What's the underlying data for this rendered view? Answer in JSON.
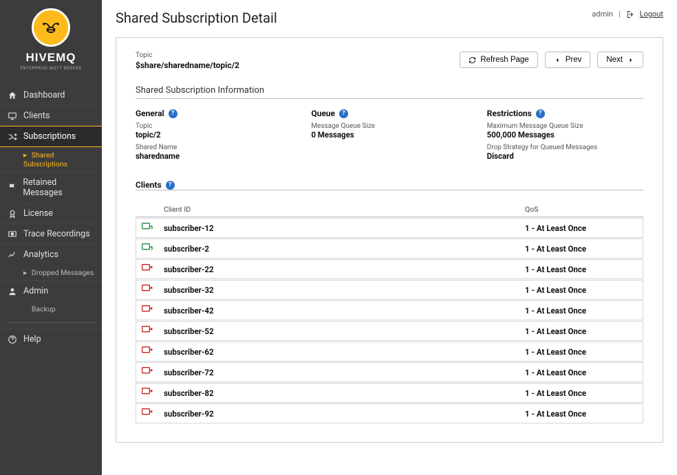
{
  "brand": {
    "name": "HIVEMQ",
    "tagline": "ENTERPRISE MQTT BROKER"
  },
  "nav": {
    "dashboard": "Dashboard",
    "clients": "Clients",
    "subscriptions": "Subscriptions",
    "shared_subscriptions": "Shared Subscriptions",
    "retained": "Retained Messages",
    "license": "License",
    "trace": "Trace Recordings",
    "analytics": "Analytics",
    "dropped": "Dropped Messages",
    "admin": "Admin",
    "backup": "Backup",
    "help": "Help"
  },
  "user": {
    "name": "admin",
    "logout": "Logout"
  },
  "page": {
    "title": "Shared Subscription Detail",
    "topic_label": "Topic",
    "topic_value": "$share/sharedname/topic/2",
    "refresh": "Refresh Page",
    "prev": "Prev",
    "next": "Next",
    "section_info": "Shared Subscription Information",
    "general": {
      "heading": "General",
      "topic_label": "Topic",
      "topic_value": "topic/2",
      "sharedname_label": "Shared Name",
      "sharedname_value": "sharedname"
    },
    "queue": {
      "heading": "Queue",
      "size_label": "Message Queue Size",
      "size_value": "0 Messages"
    },
    "restrictions": {
      "heading": "Restrictions",
      "max_label": "Maximum Message Queue Size",
      "max_value": "500,000 Messages",
      "drop_label": "Drop Strategy for Queued Messages",
      "drop_value": "Discard"
    },
    "clients_heading": "Clients",
    "table": {
      "col_clientid": "Client ID",
      "col_qos": "QoS",
      "rows": [
        {
          "status": "online",
          "id": "subscriber-12",
          "qos": "1 - At Least Once"
        },
        {
          "status": "online",
          "id": "subscriber-2",
          "qos": "1 - At Least Once"
        },
        {
          "status": "offline",
          "id": "subscriber-22",
          "qos": "1 - At Least Once"
        },
        {
          "status": "offline",
          "id": "subscriber-32",
          "qos": "1 - At Least Once"
        },
        {
          "status": "offline",
          "id": "subscriber-42",
          "qos": "1 - At Least Once"
        },
        {
          "status": "offline",
          "id": "subscriber-52",
          "qos": "1 - At Least Once"
        },
        {
          "status": "offline",
          "id": "subscriber-62",
          "qos": "1 - At Least Once"
        },
        {
          "status": "offline",
          "id": "subscriber-72",
          "qos": "1 - At Least Once"
        },
        {
          "status": "offline",
          "id": "subscriber-82",
          "qos": "1 - At Least Once"
        },
        {
          "status": "offline",
          "id": "subscriber-92",
          "qos": "1 - At Least Once"
        }
      ]
    }
  }
}
